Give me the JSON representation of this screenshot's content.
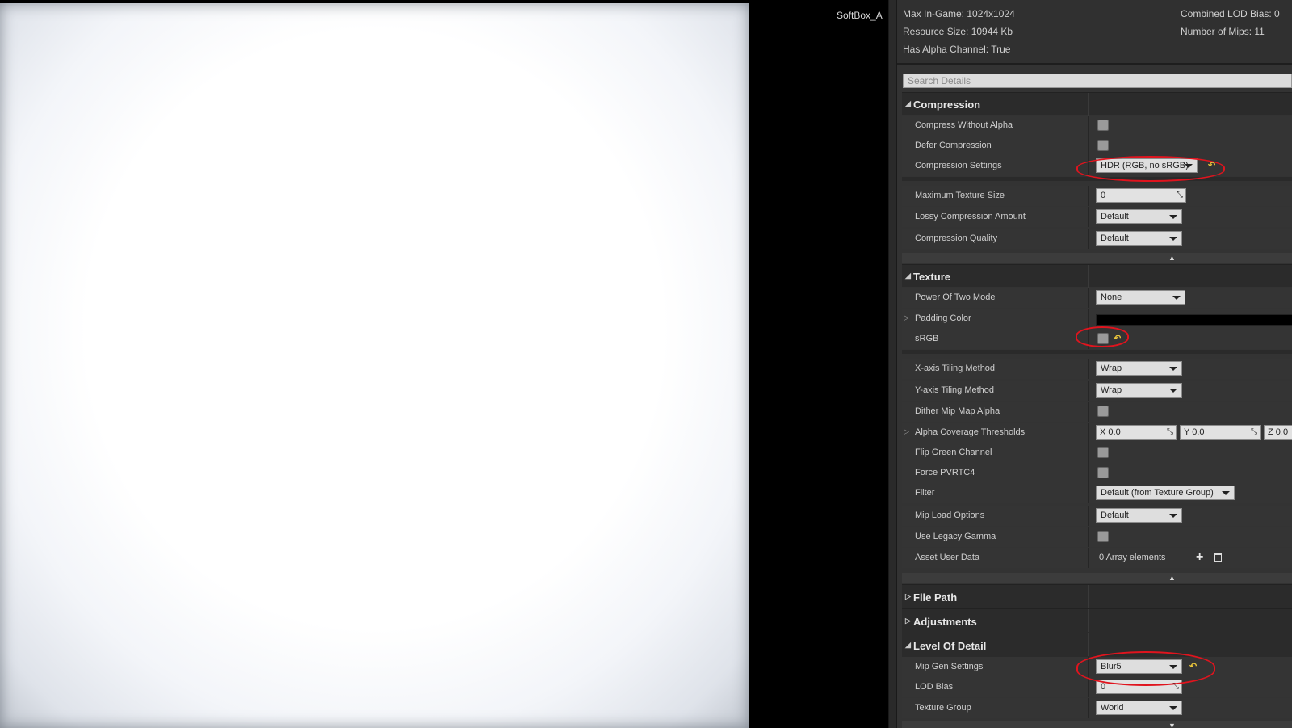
{
  "viewport": {
    "texture_name": "SoftBox_A"
  },
  "info": {
    "max_in_game": "Max In-Game: 1024x1024",
    "resource_size": "Resource Size: 10944 Kb",
    "has_alpha": "Has Alpha Channel: True",
    "combined_lod_bias": "Combined LOD Bias: 0",
    "number_of_mips": "Number of Mips: 11"
  },
  "search": {
    "placeholder": "Search Details"
  },
  "compression": {
    "title": "Compression",
    "compress_without_alpha": "Compress Without Alpha",
    "defer_compression": "Defer Compression",
    "compression_settings": "Compression Settings",
    "compression_settings_value": "HDR (RGB, no sRGB)",
    "max_texture_size": "Maximum Texture Size",
    "max_texture_size_value": "0",
    "lossy_amount": "Lossy Compression Amount",
    "lossy_amount_value": "Default",
    "quality": "Compression Quality",
    "quality_value": "Default"
  },
  "texture": {
    "title": "Texture",
    "power_of_two": "Power Of Two Mode",
    "power_of_two_value": "None",
    "padding_color": "Padding Color",
    "srgb": "sRGB",
    "x_tiling": "X-axis Tiling Method",
    "x_tiling_value": "Wrap",
    "y_tiling": "Y-axis Tiling Method",
    "y_tiling_value": "Wrap",
    "dither": "Dither Mip Map Alpha",
    "alpha_coverage": "Alpha Coverage Thresholds",
    "alpha_x": "X  0.0",
    "alpha_y": "Y  0.0",
    "alpha_z": "Z  0.0",
    "flip_green": "Flip Green Channel",
    "force_pvrtc4": "Force PVRTC4",
    "filter": "Filter",
    "filter_value": "Default (from Texture Group)",
    "mip_load": "Mip Load Options",
    "mip_load_value": "Default",
    "legacy_gamma": "Use Legacy Gamma",
    "asset_user_data": "Asset User Data",
    "asset_user_data_value": "0 Array elements"
  },
  "file_path": {
    "title": "File Path"
  },
  "adjustments": {
    "title": "Adjustments"
  },
  "lod": {
    "title": "Level Of Detail",
    "mip_gen": "Mip Gen Settings",
    "mip_gen_value": "Blur5",
    "lod_bias": "LOD Bias",
    "lod_bias_value": "0",
    "texture_group": "Texture Group",
    "texture_group_value": "World"
  },
  "colors": {
    "annotation": "#e0141e",
    "reset_arrow": "#e8c43b"
  }
}
